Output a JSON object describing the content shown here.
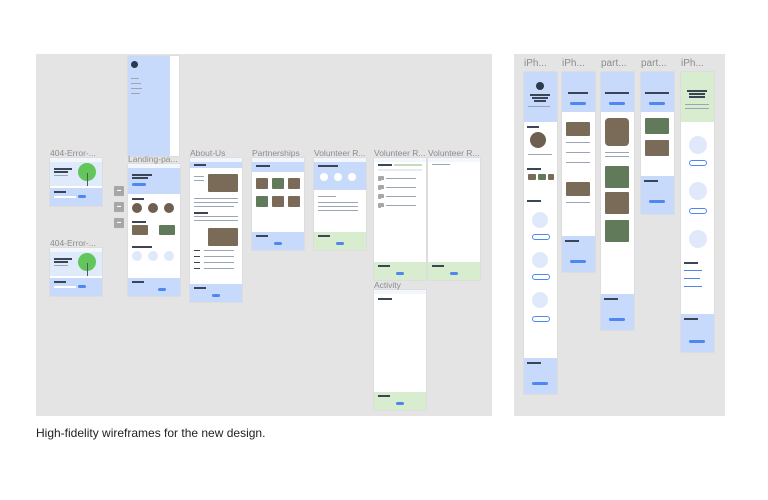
{
  "desktop_frames": {
    "error_1": "404-Error-...",
    "error_2": "404-Error-...",
    "landing": "Landing-pa...",
    "about": "About-Us",
    "partnerships": "Partnerships",
    "volunteer_1": "Volunteer R...",
    "volunteer_2": "Volunteer R...",
    "volunteer_3": "Volunteer R...",
    "activity": "Activity"
  },
  "mobile_frames": [
    "iPh...",
    "iPh...",
    "part...",
    "part...",
    "iPh..."
  ],
  "caption": "High-fidelity wireframes for the new design.",
  "colors": {
    "canvas": "#e4e4e4",
    "brand_blue": "#c7dafb",
    "accent_blue": "#4f86f0",
    "footer_green": "#d8edcf",
    "tree_green": "#62c65a"
  }
}
